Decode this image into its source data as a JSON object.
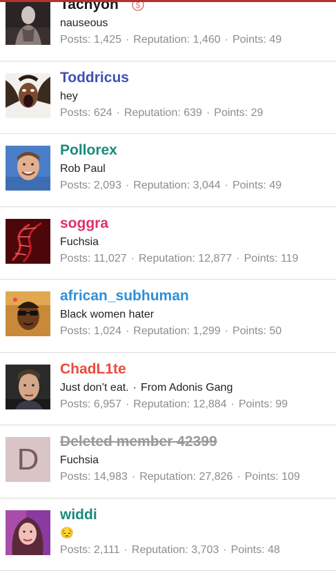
{
  "labels": {
    "posts": "Posts:",
    "reputation": "Reputation:",
    "points": "Points:",
    "separator": "·"
  },
  "members": [
    {
      "username": "Tachyon",
      "title": "nauseous",
      "title_extra": "",
      "posts": "1,425",
      "reputation": "1,460",
      "points": "49",
      "name_color": "#1a1a1a",
      "avatar_icon": "dark-figure-avatar",
      "badge_icon": "dollar-badge-icon"
    },
    {
      "username": "Toddricus",
      "title": "hey",
      "title_extra": "",
      "posts": "624",
      "reputation": "639",
      "points": "29",
      "name_color": "#3f51b5",
      "avatar_icon": "screaming-woman-avatar"
    },
    {
      "username": "Pollorex",
      "title": "Rob Paul",
      "title_extra": "",
      "posts": "2,093",
      "reputation": "3,044",
      "points": "49",
      "name_color": "#1a8a7a",
      "avatar_icon": "smiling-man-avatar"
    },
    {
      "username": "soggra",
      "title": "Fuchsia",
      "title_extra": "",
      "posts": "11,027",
      "reputation": "12,877",
      "points": "119",
      "name_color": "#e0306a",
      "avatar_icon": "dna-helix-avatar"
    },
    {
      "username": "african_subhuman",
      "title": "Black women hater",
      "title_extra": "",
      "posts": "1,024",
      "reputation": "1,299",
      "points": "50",
      "name_color": "#2f8fd8",
      "avatar_icon": "sunglasses-man-avatar"
    },
    {
      "username": "ChadL1te",
      "title": "Just don’t eat.",
      "title_extra": "From Adonis Gang",
      "posts": "6,957",
      "reputation": "12,884",
      "points": "99",
      "name_color": "#e84a3c",
      "avatar_icon": "man-portrait-avatar"
    },
    {
      "username": "Deleted member 42399",
      "title": "Fuchsia",
      "title_extra": "",
      "posts": "14,983",
      "reputation": "27,826",
      "points": "109",
      "name_color": "#9a9a9a",
      "avatar_letter": "D",
      "avatar_bg": "#d9c5c6",
      "avatar_fg": "#7a5a5c"
    },
    {
      "username": "widdi",
      "title": "😔",
      "title_extra": "",
      "posts": "2,111",
      "reputation": "3,703",
      "points": "48",
      "name_color": "#1a8a7a",
      "avatar_icon": "woman-portrait-avatar"
    }
  ]
}
